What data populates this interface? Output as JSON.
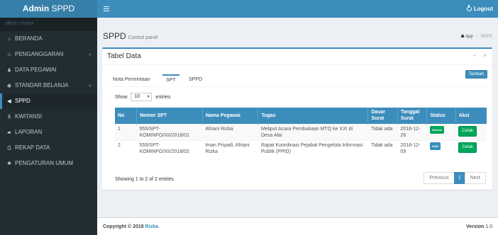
{
  "header": {
    "app_title_bold": "Admin",
    "app_title_light": "SPPD",
    "logout_label": "Logout"
  },
  "sidebar": {
    "section_label": "MENU UTAMA",
    "items": [
      {
        "label": "BERANDA",
        "icon": "home-icon",
        "glyph": "⌂",
        "has_submenu": false,
        "active": false
      },
      {
        "label": "PENGANGGARAN",
        "icon": "money-icon",
        "glyph": "♨",
        "has_submenu": true,
        "active": false
      },
      {
        "label": "DATA PEGAWAI",
        "icon": "users-icon",
        "glyph": "♟",
        "has_submenu": false,
        "active": false
      },
      {
        "label": "STANDAR BELANJA",
        "icon": "shield-icon",
        "glyph": "◉",
        "has_submenu": true,
        "active": false
      },
      {
        "label": "SPPD",
        "icon": "bullhorn-icon",
        "glyph": "◀",
        "has_submenu": false,
        "active": true
      },
      {
        "label": "KWITANSI",
        "icon": "dollar-icon",
        "glyph": "$",
        "has_submenu": false,
        "active": false
      },
      {
        "label": "LAPORAN",
        "icon": "book-icon",
        "glyph": "▰",
        "has_submenu": false,
        "active": false
      },
      {
        "label": "REKAP DATA",
        "icon": "print-icon",
        "glyph": "⎙",
        "has_submenu": false,
        "active": false
      },
      {
        "label": "PENGATURAN UMUM",
        "icon": "gear-icon",
        "glyph": "✱",
        "has_submenu": false,
        "active": false
      }
    ]
  },
  "content": {
    "title": "SPPD",
    "subtitle": "Control panel",
    "breadcrumb": {
      "home": "App",
      "current": "SPPD"
    }
  },
  "box": {
    "title": "Tabel Data",
    "tools": {
      "collapse": "−",
      "close": "×"
    },
    "tabs": [
      {
        "label": "Nota Permintaan",
        "active": false
      },
      {
        "label": "SPT",
        "active": true
      },
      {
        "label": "SPPD",
        "active": false
      }
    ],
    "add_button": "Tambah",
    "length": {
      "prefix": "Show",
      "value": "10",
      "suffix": "entries"
    },
    "table": {
      "columns": [
        "No",
        "Nomor SPT",
        "Nama Pegawai",
        "Tugas",
        "Dasar Surat",
        "Tanggal Surat",
        "Status",
        "Aksi"
      ],
      "rows": [
        {
          "no": "1",
          "nomor": "555/SPT-KOMINFO/XII/2018/01",
          "nama": "Afriani Rizka",
          "tugas": "Meliput Acara Pembukaan MTQ ke XXI di Desa Alai",
          "dasar": "Tidak ada",
          "tanggal": "2018-12-26",
          "status": "Selesai",
          "status_color": "#00a65a",
          "aksi": "Cetak"
        },
        {
          "no": "2",
          "nomor": "555/SPT-KOMINFO/XII/2018/02",
          "nama": "Iman Priyadi, Afriani Rizka",
          "tugas": "Rapat Koordinasi Pejabat Pengelola Informasi Publik (PPID)",
          "dasar": "Tidak ada",
          "tanggal": "2018-12-09",
          "status": "Aktif",
          "status_color": "#3c8dbc",
          "aksi": "Cetak"
        }
      ]
    },
    "info": "Showing 1 to 2 of 2 entries",
    "pagination": {
      "previous": "Previous",
      "current": "1",
      "next": "Next"
    }
  },
  "footer": {
    "copyright": "Copyright © 2018",
    "author": "Rizka",
    "version_label": "Version",
    "version_value": "1.0"
  }
}
